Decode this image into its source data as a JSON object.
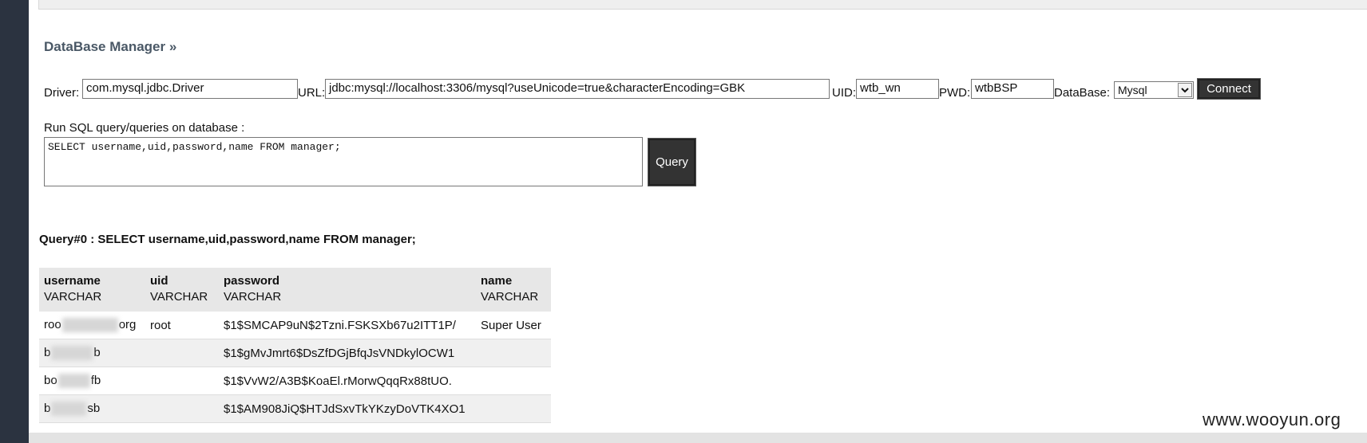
{
  "panel": {
    "title": "DataBase Manager »"
  },
  "connection": {
    "driver_label": "Driver:",
    "driver_value": "com.mysql.jdbc.Driver",
    "url_label": "URL:",
    "url_value": "jdbc:mysql://localhost:3306/mysql?useUnicode=true&characterEncoding=GBK",
    "uid_label": "UID:",
    "uid_value": "wtb_wn",
    "pwd_label": "PWD:",
    "pwd_value": "wtbBSP",
    "database_label": "DataBase:",
    "database_value": "Mysql",
    "connect_label": "Connect"
  },
  "query_form": {
    "label": "Run SQL query/queries on database :",
    "sql": "SELECT username,uid,password,name FROM manager;",
    "query_button": "Query"
  },
  "result": {
    "title": "Query#0 : SELECT username,uid,password,name FROM manager;",
    "columns": [
      {
        "name": "username",
        "type": "VARCHAR"
      },
      {
        "name": "uid",
        "type": "VARCHAR"
      },
      {
        "name": "password",
        "type": "VARCHAR"
      },
      {
        "name": "name",
        "type": "VARCHAR"
      }
    ],
    "rows": [
      {
        "username_pre": "roo",
        "username_post": "org",
        "uid": "root",
        "password": "$1$SMCAP9uN$2Tzni.FSKSXb67u2ITT1P/",
        "name": "Super User"
      },
      {
        "username_pre": "b",
        "username_post": "b",
        "uid": "",
        "password": "$1$gMvJmrt6$DsZfDGjBfqJsVNDkylOCW1",
        "name": ""
      },
      {
        "username_pre": "bo",
        "username_post": "fb",
        "uid": "",
        "password": "$1$VvW2/A3B$KoaEl.rMorwQqqRx88tUO.",
        "name": ""
      },
      {
        "username_pre": "b",
        "username_post": "sb",
        "uid": "",
        "password": "$1$AM908JiQ$HTJdSxvTkYKzyDoVTK4XO1",
        "name": ""
      }
    ]
  },
  "watermark": "www.wooyun.org",
  "icons": {
    "select_arrow": "chevron-down-icon"
  },
  "colors": {
    "sidebar": "#2b3340",
    "button": "#333333",
    "title": "#4a5866"
  }
}
